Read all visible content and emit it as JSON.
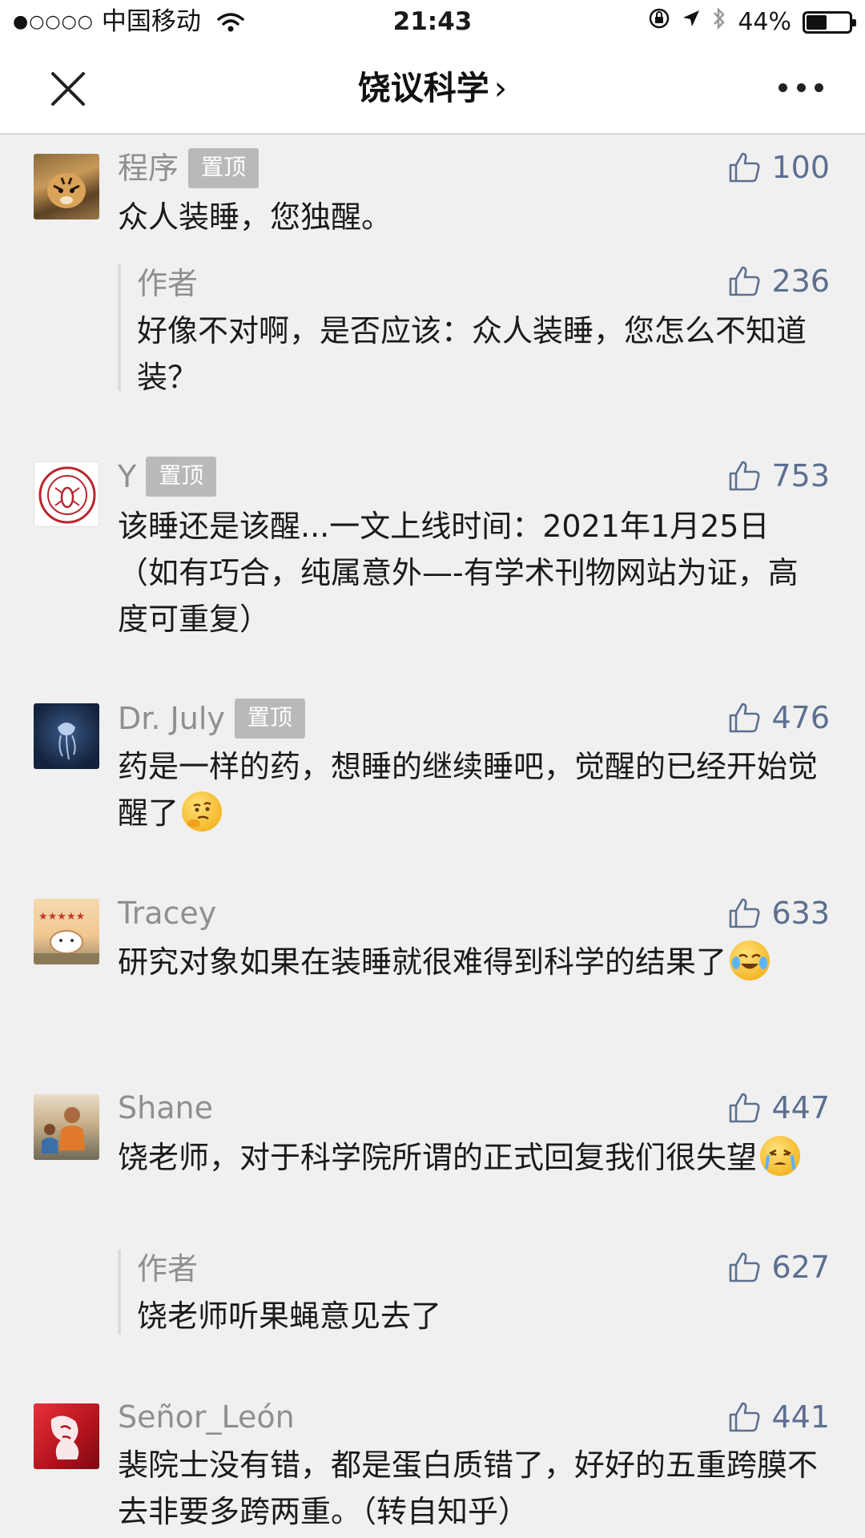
{
  "status_bar": {
    "carrier": "中国移动",
    "time": "21:43",
    "battery": "44%",
    "battery_level": 0.44
  },
  "nav": {
    "title": "饶议科学",
    "title_chevron": "›"
  },
  "comments": [
    {
      "name": "程序",
      "pinned_label": "置顶",
      "likes": "100",
      "text": "众人装睡，您独醒。",
      "reply": {
        "name": "作者",
        "likes": "236",
        "text": "好像不对啊，是否应该：众人装睡，您怎么不知道装？"
      }
    },
    {
      "name": "Y",
      "pinned_label": "置顶",
      "likes": "753",
      "text": "该睡还是该醒...一文上线时间：2021年1月25日（如有巧合，纯属意外—-有学术刊物网站为证，高度可重复）"
    },
    {
      "name": "Dr. July",
      "pinned_label": "置顶",
      "likes": "476",
      "text": "药是一样的药，想睡的继续睡吧，觉醒的已经开始觉醒了",
      "emoji": "thinking-emoji"
    },
    {
      "name": "Tracey",
      "likes": "633",
      "text": "研究对象如果在装睡就很难得到科学的结果了",
      "emoji": "laughing-emoji"
    },
    {
      "name": "Shane",
      "likes": "447",
      "text": "饶老师，对于科学院所谓的正式回复我们很失望",
      "emoji": "crying-emoji",
      "reply": {
        "name": "作者",
        "likes": "627",
        "text": "饶老师听果蝇意见去了"
      }
    },
    {
      "name": "Señor_León",
      "likes": "441",
      "text": "裴院士没有错，都是蛋白质错了，好好的五重跨膜不去非要多跨两重。（转自知乎）"
    }
  ],
  "colors": {
    "background": "#f0f0f0",
    "like_blue": "#5c6f91",
    "name_gray": "#8f8f8f",
    "pin_badge": "#b9b9b9"
  }
}
